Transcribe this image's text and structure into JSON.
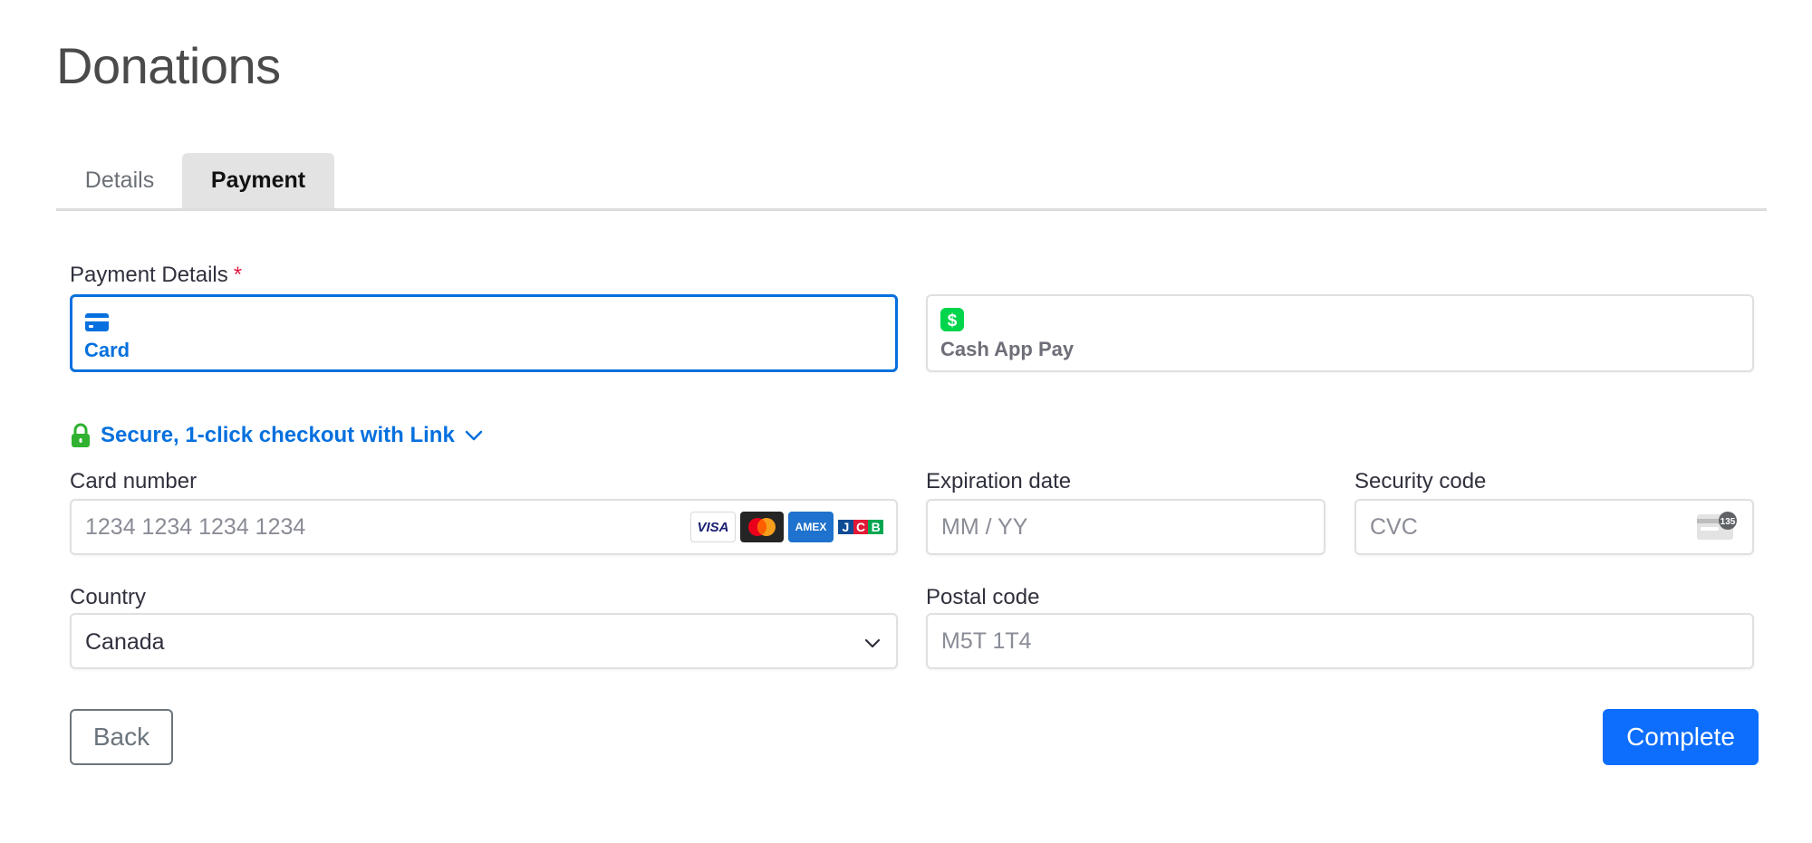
{
  "page": {
    "title": "Donations"
  },
  "tabs": [
    {
      "label": "Details",
      "active": false
    },
    {
      "label": "Payment",
      "active": true
    }
  ],
  "payment_details": {
    "label": "Payment Details",
    "required_mark": "*",
    "methods": [
      {
        "label": "Card",
        "icon": "credit-card-icon",
        "selected": true
      },
      {
        "label": "Cash App Pay",
        "icon": "cash-app-icon",
        "selected": false
      }
    ]
  },
  "link_checkout": {
    "text": "Secure, 1-click checkout with Link",
    "icon": "lock-icon"
  },
  "fields": {
    "card_number": {
      "label": "Card number",
      "placeholder": "1234 1234 1234 1234",
      "brands": [
        "VISA",
        "Mastercard",
        "AMEX",
        "JCB"
      ]
    },
    "expiration": {
      "label": "Expiration date",
      "placeholder": "MM / YY"
    },
    "security_code": {
      "label": "Security code",
      "placeholder": "CVC",
      "icon_badge": "135"
    },
    "country": {
      "label": "Country",
      "value": "Canada"
    },
    "postal_code": {
      "label": "Postal code",
      "placeholder": "M5T 1T4"
    }
  },
  "buttons": {
    "back": "Back",
    "complete": "Complete"
  },
  "colors": {
    "accent": "#0570de",
    "primary_button": "#0d6efd",
    "cash_app": "#00d54b",
    "lock": "#30b130",
    "required": "#df1b41"
  }
}
